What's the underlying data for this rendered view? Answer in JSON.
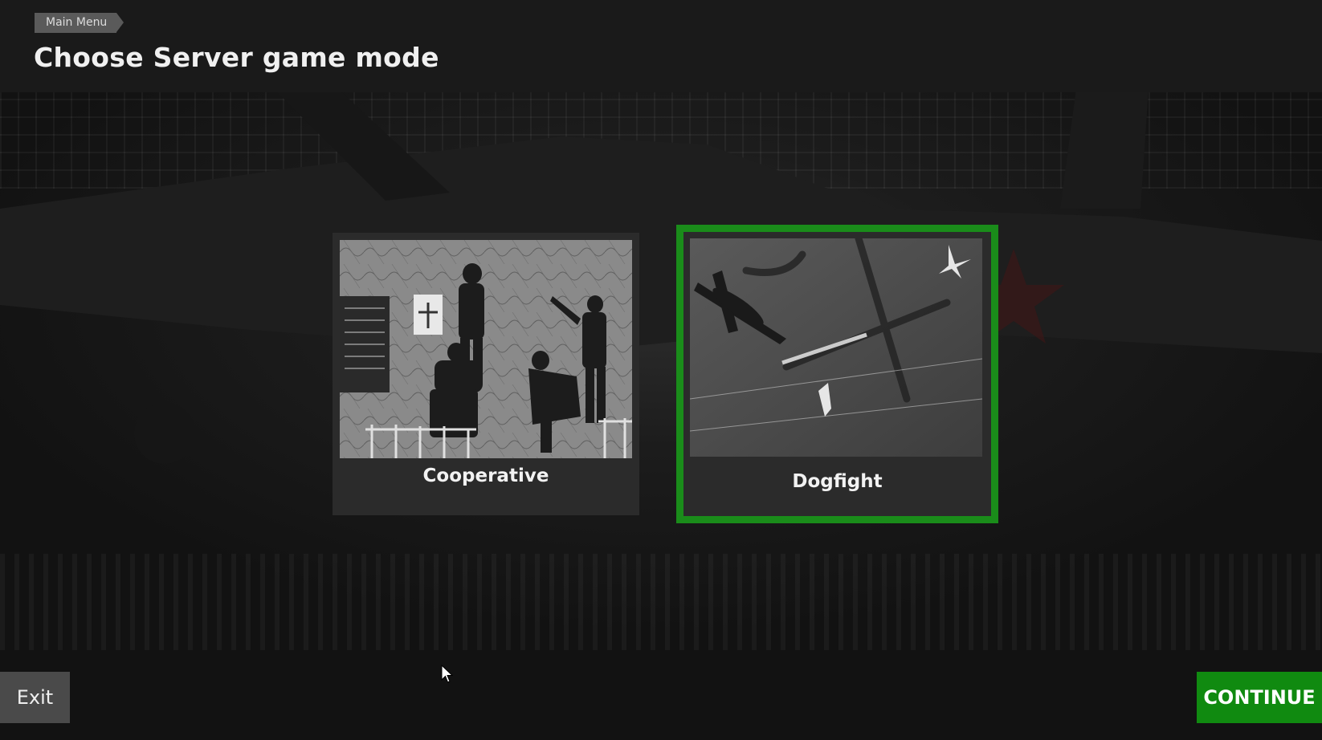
{
  "header": {
    "breadcrumb": "Main Menu",
    "title": "Choose Server game mode"
  },
  "modes": [
    {
      "label": "Cooperative",
      "image": "map-room-photo",
      "selected": false
    },
    {
      "label": "Dogfight",
      "image": "aerial-dogfight-photo",
      "selected": true
    }
  ],
  "footer": {
    "exit_label": "Exit",
    "continue_label": "CONTINUE"
  },
  "colors": {
    "accent": "#108a10",
    "selection_border": "#1a8c1a",
    "card_bg": "#2b2b2b",
    "exit_bg": "#4a4a4a"
  },
  "icons": {
    "cursor": "mouse-pointer-icon"
  }
}
